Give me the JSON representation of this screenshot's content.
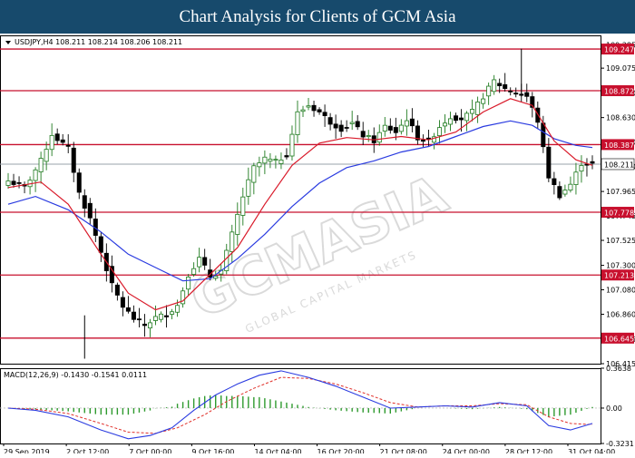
{
  "banner": {
    "title": "Chart Analysis for Clients of GCM Asia"
  },
  "colors": {
    "background": "#ffffff",
    "banner": "#174a6c",
    "bull": "#1e7a1e",
    "bear": "#000000",
    "ma_fast": "#d91a2a",
    "ma_slow": "#2a3be0",
    "level_line": "#c8102e",
    "level_label_bg": "#c8102e",
    "macd_hist": "#2e9a2e",
    "macd_signal": "#e0302a",
    "macd_line": "#2a3be0"
  },
  "chart_data": [
    {
      "type": "candlestick",
      "symbol_label": "USDJPY,H4  108.211 108.214 108.206 108.211",
      "ylim": [
        106.415,
        109.37
      ],
      "y_ticks": [
        "109.285",
        "109.075",
        "108.850",
        "108.630",
        "108.410",
        "108.190",
        "107.965",
        "107.745",
        "107.525",
        "107.300",
        "107.080",
        "106.860",
        "106.635",
        "106.415"
      ],
      "x_ticks": [
        "29 Sep 2019",
        "2 Oct 12:00",
        "7 Oct 00:00",
        "9 Oct 16:00",
        "14 Oct 04:00",
        "16 Oct 20:00",
        "21 Oct 08:00",
        "24 Oct 00:00",
        "28 Oct 12:00",
        "31 Oct 04:00"
      ],
      "current_price": "108.211",
      "levels": [
        "109.247",
        "108.872",
        "108.387",
        "107.778",
        "107.213",
        "106.645"
      ],
      "close_path": [
        [
          0,
          108.06
        ],
        [
          3,
          108.0
        ],
        [
          6,
          108.24
        ],
        [
          8,
          108.48
        ],
        [
          11,
          108.35
        ],
        [
          13,
          107.95
        ],
        [
          15,
          107.72
        ],
        [
          17,
          107.42
        ],
        [
          19,
          107.12
        ],
        [
          21,
          106.93
        ],
        [
          23,
          106.82
        ],
        [
          25,
          106.76
        ],
        [
          27,
          106.83
        ],
        [
          29,
          106.86
        ],
        [
          31,
          106.94
        ],
        [
          33,
          107.22
        ],
        [
          35,
          107.36
        ],
        [
          37,
          107.2
        ],
        [
          39,
          107.25
        ],
        [
          41,
          107.58
        ],
        [
          43,
          107.92
        ],
        [
          45,
          108.18
        ],
        [
          47,
          108.26
        ],
        [
          49,
          108.23
        ],
        [
          51,
          108.3
        ],
        [
          53,
          108.67
        ],
        [
          55,
          108.74
        ],
        [
          57,
          108.68
        ],
        [
          59,
          108.59
        ],
        [
          61,
          108.53
        ],
        [
          63,
          108.58
        ],
        [
          65,
          108.47
        ],
        [
          67,
          108.42
        ],
        [
          69,
          108.55
        ],
        [
          71,
          108.5
        ],
        [
          73,
          108.62
        ],
        [
          75,
          108.45
        ],
        [
          77,
          108.41
        ],
        [
          79,
          108.55
        ],
        [
          81,
          108.64
        ],
        [
          83,
          108.62
        ],
        [
          85,
          108.68
        ],
        [
          87,
          108.82
        ],
        [
          89,
          108.96
        ],
        [
          91,
          108.89
        ],
        [
          93,
          108.85
        ],
        [
          95,
          108.82
        ],
        [
          97,
          108.6
        ],
        [
          99,
          108.1
        ],
        [
          101,
          107.93
        ],
        [
          103,
          108.03
        ],
        [
          105,
          108.22
        ],
        [
          107,
          108.21
        ]
      ],
      "ma_fast_path": [
        [
          0,
          108.0
        ],
        [
          6,
          108.05
        ],
        [
          11,
          107.85
        ],
        [
          17,
          107.4
        ],
        [
          22,
          107.05
        ],
        [
          27,
          106.9
        ],
        [
          32,
          106.98
        ],
        [
          37,
          107.22
        ],
        [
          42,
          107.46
        ],
        [
          47,
          107.85
        ],
        [
          52,
          108.2
        ],
        [
          57,
          108.4
        ],
        [
          62,
          108.45
        ],
        [
          67,
          108.43
        ],
        [
          72,
          108.46
        ],
        [
          77,
          108.43
        ],
        [
          82,
          108.5
        ],
        [
          87,
          108.68
        ],
        [
          92,
          108.8
        ],
        [
          96,
          108.74
        ],
        [
          100,
          108.42
        ],
        [
          104,
          108.25
        ],
        [
          107,
          108.2
        ]
      ],
      "ma_slow_path": [
        [
          0,
          107.85
        ],
        [
          5,
          107.92
        ],
        [
          11,
          107.8
        ],
        [
          17,
          107.6
        ],
        [
          22,
          107.4
        ],
        [
          27,
          107.28
        ],
        [
          32,
          107.16
        ],
        [
          37,
          107.18
        ],
        [
          42,
          107.36
        ],
        [
          47,
          107.58
        ],
        [
          52,
          107.83
        ],
        [
          57,
          108.04
        ],
        [
          62,
          108.18
        ],
        [
          67,
          108.24
        ],
        [
          72,
          108.32
        ],
        [
          77,
          108.37
        ],
        [
          82,
          108.46
        ],
        [
          87,
          108.55
        ],
        [
          92,
          108.6
        ],
        [
          96,
          108.56
        ],
        [
          100,
          108.44
        ],
        [
          104,
          108.38
        ],
        [
          107,
          108.36
        ]
      ]
    },
    {
      "type": "macd",
      "label": "MACD(12,26,9) -0.1430 -0.1541 0.0111",
      "ylim": [
        -0.3231,
        0.3638
      ],
      "y_ticks": [
        "0.3638",
        "0.00",
        "-0.3231"
      ],
      "line": [
        [
          0,
          0.0
        ],
        [
          5,
          -0.02
        ],
        [
          11,
          -0.08
        ],
        [
          17,
          -0.2
        ],
        [
          22,
          -0.28
        ],
        [
          26,
          -0.25
        ],
        [
          30,
          -0.18
        ],
        [
          34,
          -0.02
        ],
        [
          38,
          0.12
        ],
        [
          42,
          0.22
        ],
        [
          46,
          0.3
        ],
        [
          50,
          0.34
        ],
        [
          55,
          0.28
        ],
        [
          60,
          0.2
        ],
        [
          65,
          0.1
        ],
        [
          70,
          0.0
        ],
        [
          75,
          0.01
        ],
        [
          80,
          0.02
        ],
        [
          85,
          0.01
        ],
        [
          90,
          0.05
        ],
        [
          95,
          0.02
        ],
        [
          99,
          -0.16
        ],
        [
          103,
          -0.2
        ],
        [
          107,
          -0.14
        ]
      ],
      "signal": [
        [
          0,
          0.0
        ],
        [
          5,
          -0.01
        ],
        [
          11,
          -0.05
        ],
        [
          17,
          -0.14
        ],
        [
          22,
          -0.22
        ],
        [
          27,
          -0.23
        ],
        [
          31,
          -0.18
        ],
        [
          36,
          -0.06
        ],
        [
          40,
          0.06
        ],
        [
          45,
          0.18
        ],
        [
          50,
          0.28
        ],
        [
          55,
          0.27
        ],
        [
          60,
          0.22
        ],
        [
          65,
          0.14
        ],
        [
          70,
          0.05
        ],
        [
          75,
          0.01
        ],
        [
          80,
          0.02
        ],
        [
          85,
          0.02
        ],
        [
          90,
          0.04
        ],
        [
          95,
          0.03
        ],
        [
          99,
          -0.08
        ],
        [
          103,
          -0.14
        ],
        [
          107,
          -0.15
        ]
      ]
    }
  ],
  "watermark": {
    "main": "GCMASIA",
    "secondary": "GLOBAL CAPITAL MARKETS"
  }
}
